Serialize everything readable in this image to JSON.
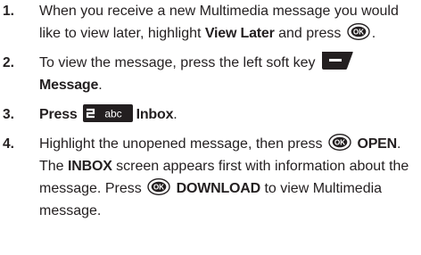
{
  "steps": [
    {
      "number": "1.",
      "line1_text": "When you receive a new Multimedia message you would",
      "line2_pre": "like to view later, highlight ",
      "line2_bold": "View Later",
      "line2_mid": " and press ",
      "line2_post": "."
    },
    {
      "number": "2.",
      "line1_text": "To view the message, press the left soft key",
      "line2_bold": "Message",
      "line2_post": "."
    },
    {
      "number": "3.",
      "line1_bold": "Press",
      "line1_bold2": "Inbox",
      "line1_post": "."
    },
    {
      "number": "4.",
      "line1_text": "Highlight the unopened message, then press ",
      "line1_bold": "OPEN",
      "line1_post": ".",
      "line2_pre": "The ",
      "line2_bold": "INBOX",
      "line2_post": " screen appears first with information about the",
      "line3_pre": "message. Press ",
      "line3_bold": "DOWNLOAD",
      "line3_post": " to view Multimedia",
      "line4_text": "message."
    }
  ],
  "icons": {
    "ok_key": "ok-key-icon",
    "left_soft_key": "left-soft-key-icon",
    "abc_key": "two-abc-key-icon",
    "ok_key_label": "OK",
    "abc_key_label": "abc"
  },
  "colors": {
    "text": "#231f20",
    "key_fill": "#231f20",
    "key_text": "#ffffff"
  }
}
